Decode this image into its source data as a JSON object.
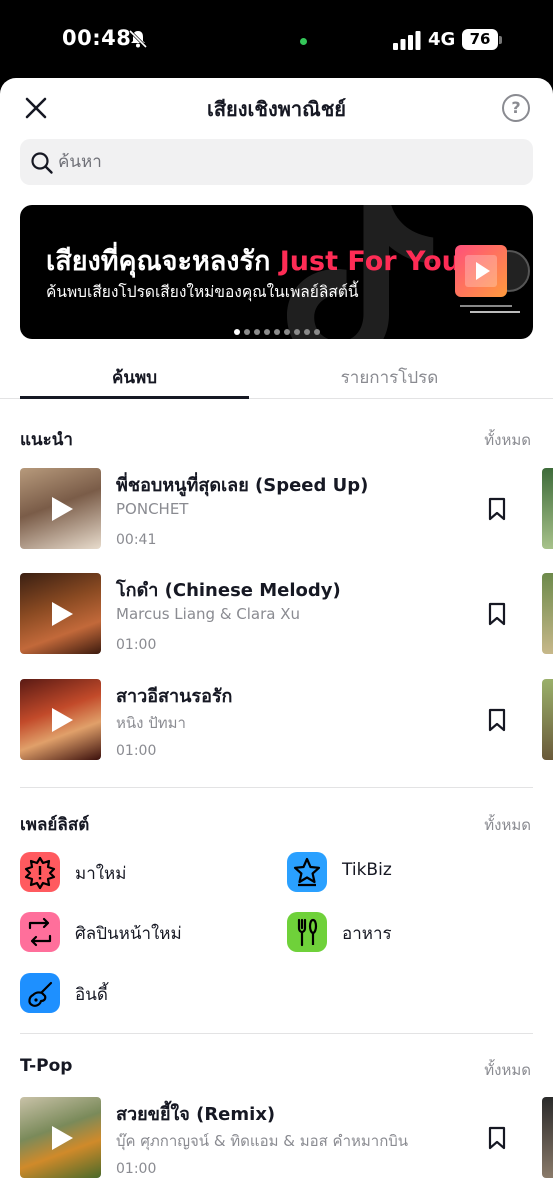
{
  "status_bar": {
    "time": "00:48",
    "network": "4G",
    "battery": "76"
  },
  "header": {
    "title": "เสียงเชิงพาณิชย์",
    "help": "?"
  },
  "search": {
    "placeholder": "ค้นหา"
  },
  "banner": {
    "title_main": "เสียงที่คุณจะหลงรัก",
    "title_accent": "Just For You",
    "subtitle": "ค้นพบเสียงโปรดเสียงใหม่ของคุณในเพลย์ลิสต์นี้",
    "page_count": 9,
    "active_page": 1
  },
  "tabs": [
    {
      "label": "ค้นพบ",
      "selected": true
    },
    {
      "label": "รายการโปรด",
      "selected": false
    }
  ],
  "recommended": {
    "title": "แนะนำ",
    "see_all": "ทั้งหมด",
    "tracks": [
      {
        "title": "พี่ชอบหนูที่สุดเลย (Speed Up)",
        "artist": "PONCHET",
        "duration": "00:41"
      },
      {
        "title": "โกดำ (Chinese Melody)",
        "artist": "Marcus Liang & Clara Xu",
        "duration": "01:00"
      },
      {
        "title": "สาวอีสานรอรัก",
        "artist": "หนิง ปัทมา",
        "duration": "01:00"
      }
    ]
  },
  "playlists": {
    "title": "เพลย์ลิสต์",
    "see_all": "ทั้งหมด",
    "items": [
      {
        "label": "มาใหม่",
        "icon": "new-badge-icon",
        "color": "#ff5a5f"
      },
      {
        "label": "TikBiz",
        "icon": "star-icon",
        "color": "#2aa0ff"
      },
      {
        "label": "ศิลปินหน้าใหม่",
        "icon": "swap-arrows-icon",
        "color": "#ff6f9b"
      },
      {
        "label": "อาหาร",
        "icon": "utensils-icon",
        "color": "#6fd13a"
      },
      {
        "label": "อินดี้",
        "icon": "guitar-icon",
        "color": "#1e90ff"
      }
    ]
  },
  "tpop": {
    "title": "T-Pop",
    "see_all": "ทั้งหมด",
    "tracks": [
      {
        "title": "สวยขยี้ใจ (Remix)",
        "artist": "บุ๊ค ศุภกาญจน์ & ทิดแอม & มอส คำหมากบิน",
        "duration": "01:00"
      }
    ]
  }
}
